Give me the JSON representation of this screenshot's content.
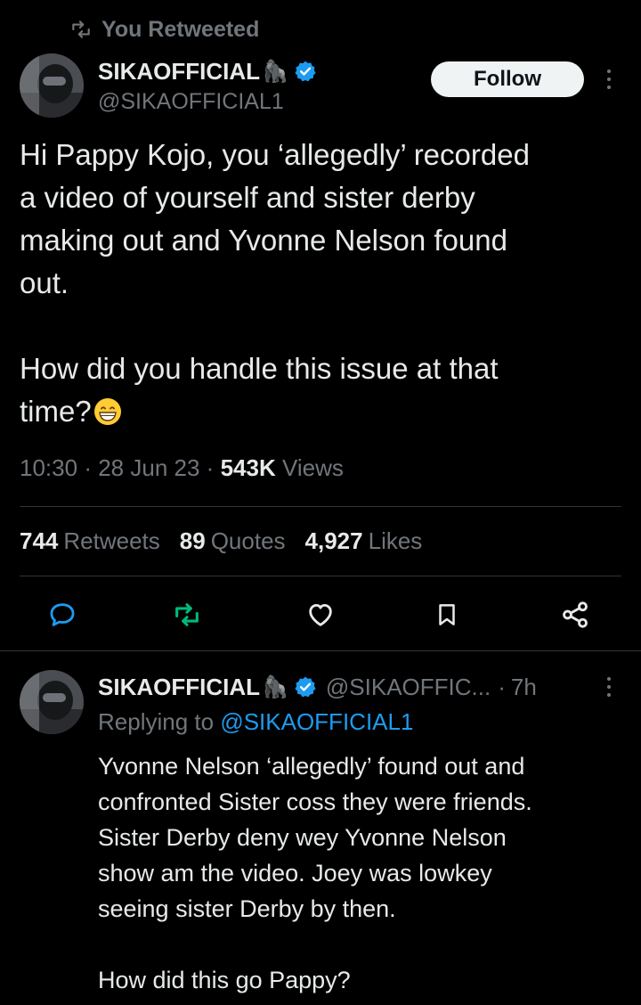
{
  "context": {
    "retweeted_label": "You Retweeted"
  },
  "tweet": {
    "display_name": "SIKAOFFICIAL",
    "name_emoji": "🦍",
    "handle": "@SIKAOFFICIAL1",
    "follow_label": "Follow",
    "body_lines": [
      "Hi Pappy Kojo, you ‘allegedly’ recorded",
      "a video of yourself and sister derby",
      "making out and Yvonne Nelson found",
      "out."
    ],
    "body_question": "How did you handle this issue at that",
    "body_question_end": "time?",
    "time": "10:30",
    "date": "28 Jun 23",
    "views_count": "543K",
    "views_label": "Views",
    "sep": "·"
  },
  "stats": {
    "retweets_count": "744",
    "retweets_label": "Retweets",
    "quotes_count": "89",
    "quotes_label": "Quotes",
    "likes_count": "4,927",
    "likes_label": "Likes"
  },
  "reply": {
    "display_name": "SIKAOFFICIAL",
    "name_emoji": "🦍",
    "handle": "@SIKAOFFIC...",
    "sep": "·",
    "age": "7h",
    "replying_prefix": "Replying to",
    "replying_to": "@SIKAOFFICIAL1",
    "body_lines": [
      "Yvonne Nelson ‘allegedly’ found out and",
      "confronted Sister coss they were friends.",
      "Sister Derby deny wey Yvonne Nelson",
      "show am the video. Joey was lowkey",
      "seeing sister Derby by then."
    ],
    "body_question": "How did this go Pappy?"
  },
  "colors": {
    "background": "#000000",
    "text": "#e7e9ea",
    "muted": "#71767b",
    "accent_blue": "#1d9bf0",
    "retweet_green": "#00ba7c",
    "divider": "#2f3336"
  },
  "icons": [
    "retweet-icon",
    "verified-badge-icon",
    "reply-icon",
    "retweet-icon",
    "like-icon",
    "bookmark-icon",
    "share-icon",
    "more-icon",
    "grinning-emoji"
  ]
}
